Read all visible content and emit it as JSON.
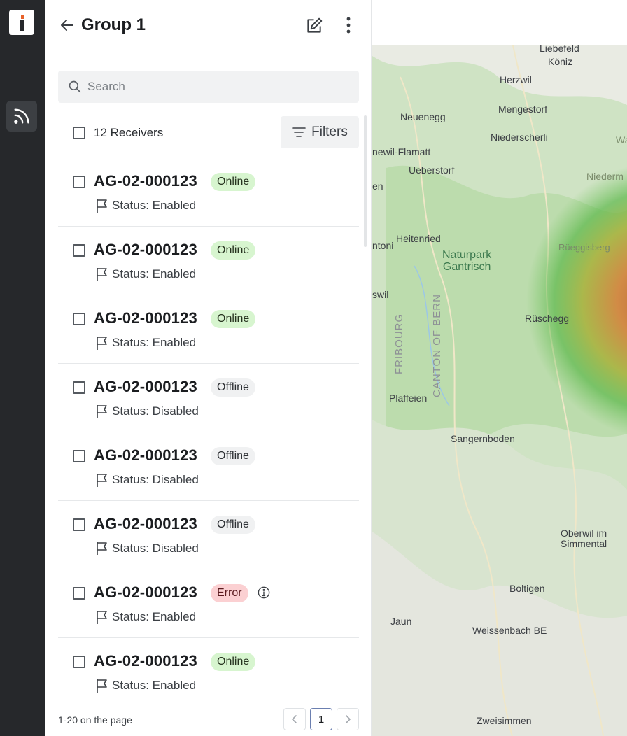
{
  "header": {
    "title": "Group 1"
  },
  "search": {
    "placeholder": "Search"
  },
  "receivers": {
    "count_label": "12 Receivers",
    "filters_label": "Filters"
  },
  "items": [
    {
      "name": "AG-02-000123",
      "badge": "Online",
      "badge_type": "online",
      "status": "Status: Enabled"
    },
    {
      "name": "AG-02-000123",
      "badge": "Online",
      "badge_type": "online",
      "status": "Status: Enabled"
    },
    {
      "name": "AG-02-000123",
      "badge": "Online",
      "badge_type": "online",
      "status": "Status: Enabled"
    },
    {
      "name": "AG-02-000123",
      "badge": "Offline",
      "badge_type": "offline",
      "status": "Status: Disabled"
    },
    {
      "name": "AG-02-000123",
      "badge": "Offline",
      "badge_type": "offline",
      "status": "Status: Disabled"
    },
    {
      "name": "AG-02-000123",
      "badge": "Offline",
      "badge_type": "offline",
      "status": "Status: Disabled"
    },
    {
      "name": "AG-02-000123",
      "badge": "Error",
      "badge_type": "error",
      "status": "Status: Enabled",
      "info_icon": "info-icon"
    },
    {
      "name": "AG-02-000123",
      "badge": "Online",
      "badge_type": "online",
      "status": "Status: Enabled"
    }
  ],
  "footer": {
    "page_info": "1-20 on the page",
    "current_page": "1"
  },
  "map": {
    "labels": {
      "liebefeld": "Liebefeld",
      "koniz": "Köniz",
      "herzwil": "Herzwil",
      "neuenegg": "Neuenegg",
      "mengestorf": "Mengestorf",
      "niederscherli": "Niederscherli",
      "flamatt": "newil-Flamatt",
      "ueberstorf": "Ueberstorf",
      "en": "en",
      "wa": "Wa",
      "niederm": "Niederm",
      "heitenried": "Heitenried",
      "ntoni": "ntoni",
      "park_line1": "Naturpark",
      "park_line2": "Gantrisch",
      "rueggisberg": "Rüeggisberg",
      "swil": "swil",
      "ruschegg": "Rüschegg",
      "fribourg": "FRIBOURG",
      "canton_bern": "CANTON OF BERN",
      "plaffeien": "Plaffeien",
      "sangernboden": "Sangernboden",
      "oberwil_line1": "Oberwil im",
      "oberwil_line2": "Simmental",
      "boltigen": "Boltigen",
      "jaun": "Jaun",
      "weissenbach": "Weissenbach BE",
      "zweisimmen": "Zweisimmen"
    }
  },
  "colors": {
    "rail": "#26282b",
    "logo_accent": "#e8622a",
    "badge_online": "#d7f5cf",
    "badge_offline": "#f0f1f2",
    "badge_error": "#fbd0d2"
  }
}
